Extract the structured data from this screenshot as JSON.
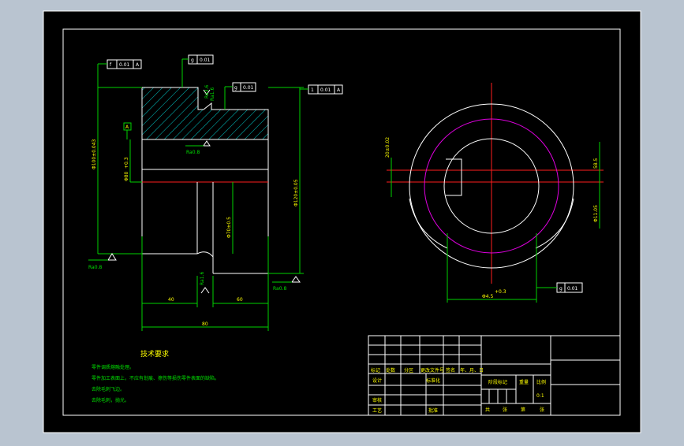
{
  "title_block": {
    "row_headers": [
      "标记",
      "处数",
      "分区",
      "更改文件号",
      "签名",
      "年、月、日"
    ],
    "design_label": "设计",
    "standardize_label": "标准化",
    "review_label": "审核",
    "process_label": "工艺",
    "approve_label": "批准",
    "stage_mark_label": "阶段标记",
    "weight_label": "重量",
    "scale_label": "比例",
    "scale_value": "0:1",
    "sheet_total_label": "共",
    "sheet_label": "张",
    "sheet_number_label": "第",
    "sheet_unit_label": "张"
  },
  "tech_req": {
    "title": "技术要求",
    "lines": [
      "零件调质熔融处理。",
      "零件加工表面上，不应有划痕、擦伤等损伤零件表面的缺陷。",
      "去除毛刺飞边。",
      "去除毛刺，抛光。"
    ]
  },
  "left_view": {
    "tolerance_frames": [
      {
        "symbol": "f",
        "value": "0.01",
        "datum": "A"
      },
      {
        "symbol": "g",
        "value": "0.01",
        "datum": ""
      },
      {
        "symbol": "g",
        "value": "0.01",
        "datum": ""
      },
      {
        "symbol": "1",
        "value": "0.01",
        "datum": "A"
      }
    ],
    "datum_label": "A",
    "roughness_labels": [
      "Ra1.6",
      "Ra0.8",
      "Ra0.8",
      "Ra1.6",
      "Ra3.6",
      "Ra0.8"
    ],
    "dims": {
      "bottom_left": "40",
      "bottom_right": "60",
      "total_width": "80",
      "left_outer_dia": "Φ100±0.043",
      "left_inner_dia": "Φ80",
      "left_inner_tol": "+0.3",
      "bore_dia": "Φ70±0.5",
      "right_outer_dia": "Φ120±0.05"
    }
  },
  "right_view": {
    "dim_left": "20±0.02",
    "dim_right_top": "58.5",
    "dim_right_bottom": "Φ11.05",
    "dim_bottom": "Φ4.5",
    "dim_bottom_tol": "+0.3",
    "tolerance_frame": {
      "symbol": "g",
      "value": "0.01"
    }
  }
}
